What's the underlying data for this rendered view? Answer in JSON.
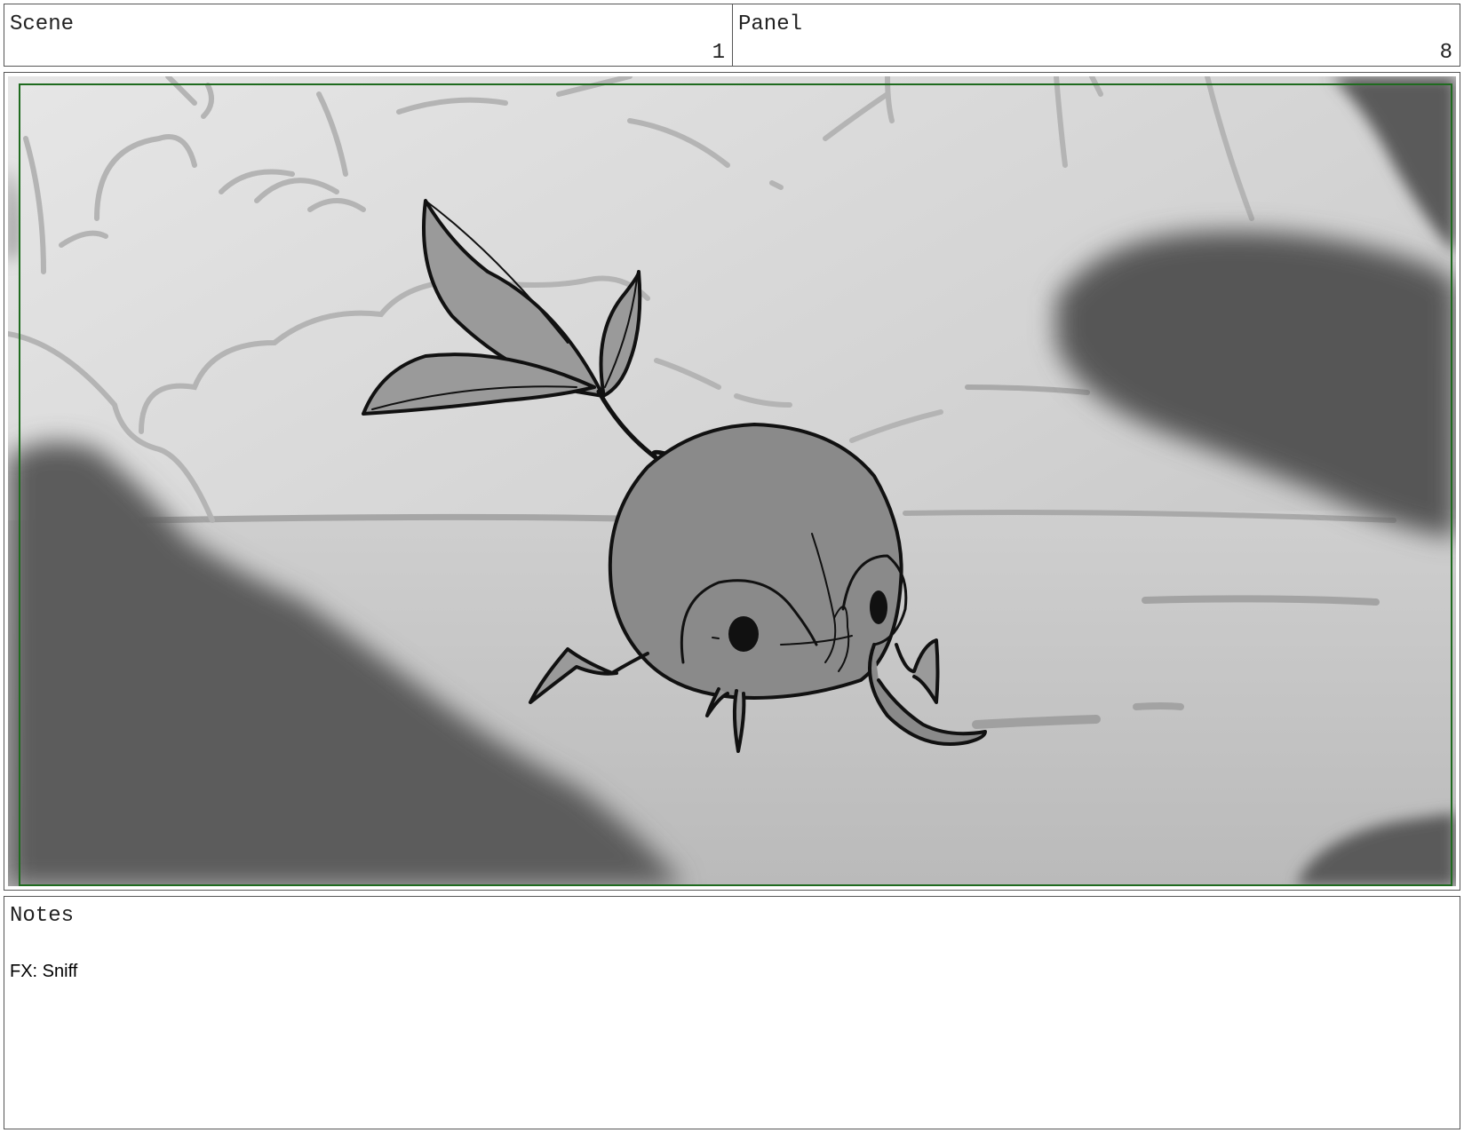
{
  "header": {
    "scene_label": "Scene",
    "scene_number": "1",
    "panel_label": "Panel",
    "panel_number": "8"
  },
  "notes": {
    "label": "Notes",
    "text": "FX: Sniff"
  },
  "colors": {
    "safe_frame": "#1f6b1f",
    "cell_border": "#555555",
    "sketch_line": "#111111",
    "character_fill": "#8a8a8a",
    "background_light": "#e2e2e2",
    "foreground_blur": "#5c5c5c"
  }
}
